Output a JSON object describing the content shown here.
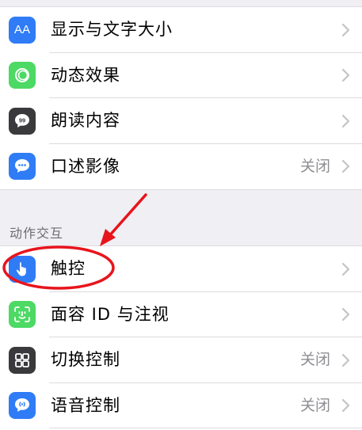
{
  "colors": {
    "blue": "#2f7cf6",
    "green": "#4cd964",
    "dark": "#3a3a3c",
    "annotation_red": "#e8141c"
  },
  "display_group": {
    "items": [
      {
        "label": "显示与文字大小",
        "value": "",
        "icon": "text-size-icon"
      },
      {
        "label": "动态效果",
        "value": "",
        "icon": "motion-icon"
      },
      {
        "label": "朗读内容",
        "value": "",
        "icon": "spoken-content-icon"
      },
      {
        "label": "口述影像",
        "value": "关闭",
        "icon": "audio-description-icon"
      }
    ]
  },
  "interaction_section": {
    "header": "动作交互",
    "items": [
      {
        "label": "触控",
        "value": "",
        "icon": "touch-icon"
      },
      {
        "label": "面容 ID 与注视",
        "value": "",
        "icon": "face-id-icon"
      },
      {
        "label": "切换控制",
        "value": "关闭",
        "icon": "switch-control-icon"
      },
      {
        "label": "语音控制",
        "value": "关闭",
        "icon": "voice-control-icon"
      }
    ]
  },
  "icon_text": {
    "text_size": "AA"
  }
}
